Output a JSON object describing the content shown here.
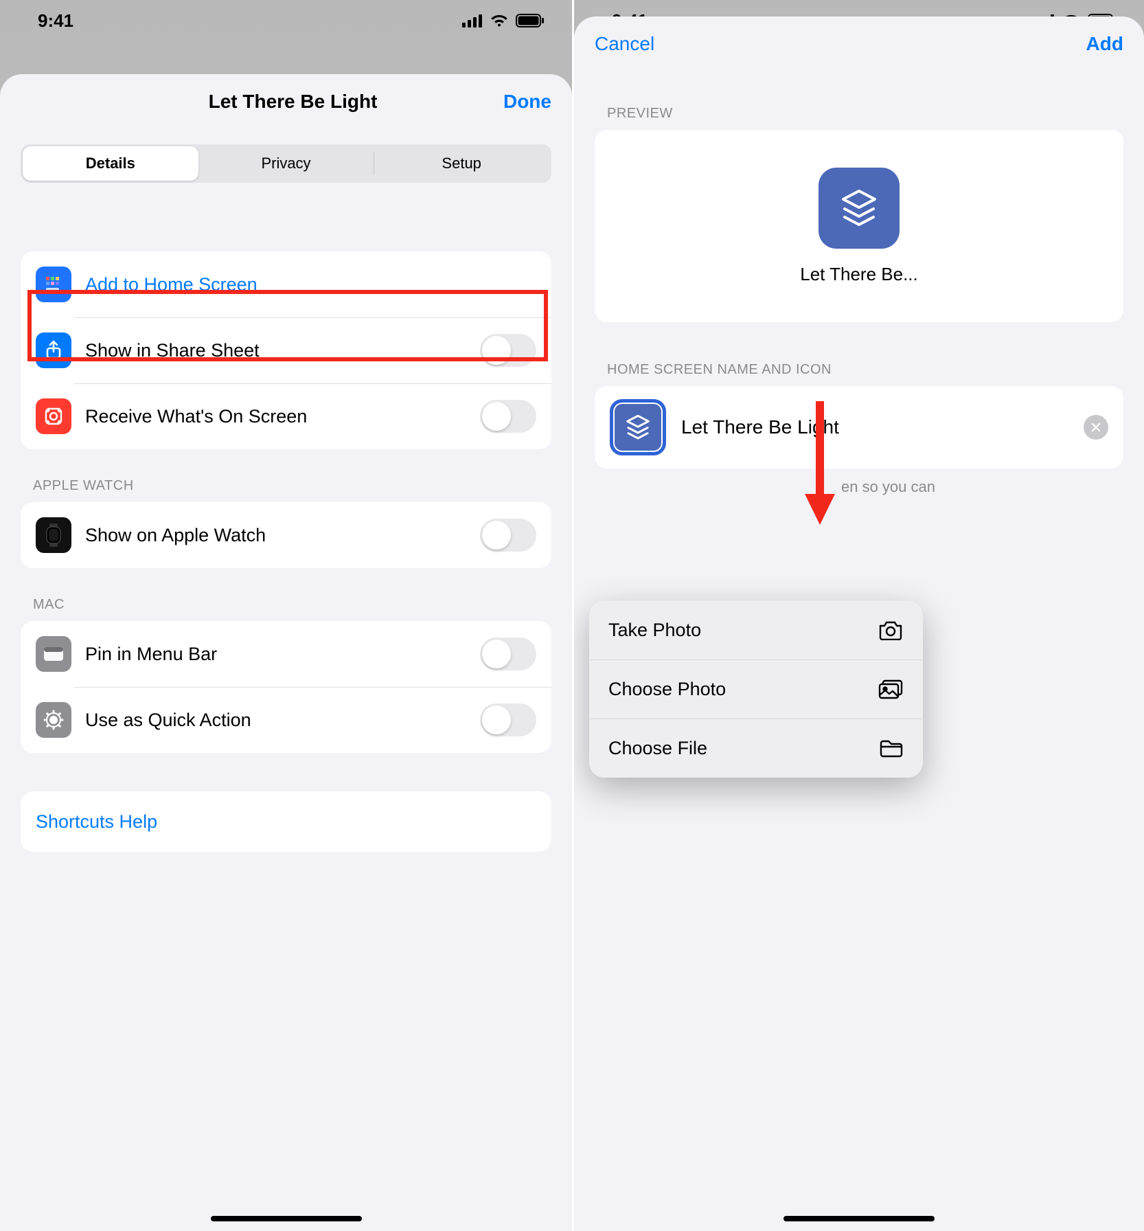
{
  "status": {
    "time": "9:41"
  },
  "left": {
    "title": "Let There Be Light",
    "done": "Done",
    "tabs": {
      "details": "Details",
      "privacy": "Privacy",
      "setup": "Setup"
    },
    "rows": {
      "add_home": "Add to Home Screen",
      "share_sheet": "Show in Share Sheet",
      "receive_screen": "Receive What's On Screen"
    },
    "sections": {
      "apple_watch": "APPLE WATCH",
      "mac": "MAC"
    },
    "watch_row": "Show on Apple Watch",
    "mac_rows": {
      "pin": "Pin in Menu Bar",
      "quick": "Use as Quick Action"
    },
    "help": "Shortcuts Help"
  },
  "right": {
    "cancel": "Cancel",
    "add": "Add",
    "preview_label": "PREVIEW",
    "preview_name": "Let There Be...",
    "section_name": "HOME SCREEN NAME AND ICON",
    "shortcut_name": "Let There Be Light",
    "hint_tail": "en so you can",
    "menu": {
      "take": "Take Photo",
      "choose": "Choose Photo",
      "file": "Choose File"
    }
  }
}
